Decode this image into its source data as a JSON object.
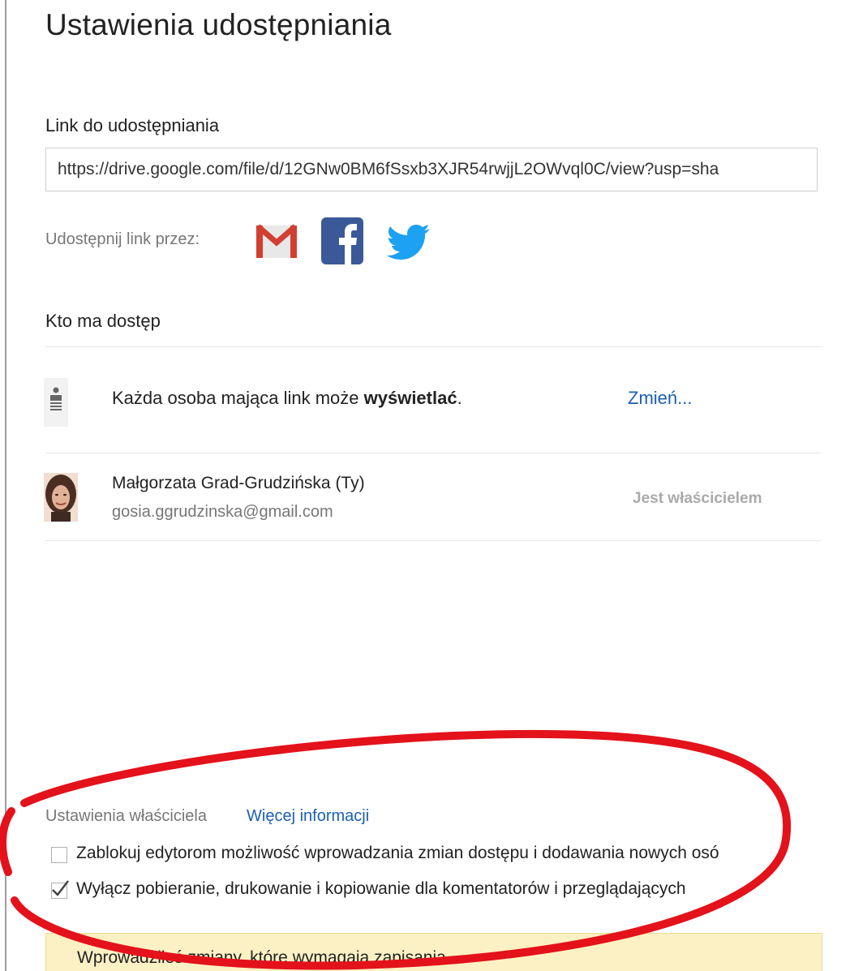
{
  "dialog": {
    "title": "Ustawienia udostępniania"
  },
  "link_section": {
    "label": "Link do udostępniania",
    "url": "https://drive.google.com/file/d/12GNw0BM6fSsxb3XJR54rwjjL2OWvql0C/view?usp=sha",
    "share_via_label": "Udostępnij link przez:",
    "share_icons": [
      "gmail-icon",
      "facebook-icon",
      "twitter-icon"
    ]
  },
  "access_section": {
    "label": "Kto ma dostęp",
    "link_row": {
      "text_prefix": "Każda osoba mająca link może ",
      "text_bold": "wyświetlać",
      "text_suffix": ".",
      "change_label": "Zmień..."
    },
    "owner_row": {
      "name": "Małgorzata Grad-Grudzińska (Ty)",
      "email": "gosia.ggrudzinska@gmail.com",
      "role": "Jest właścicielem"
    }
  },
  "owner_settings": {
    "label": "Ustawienia właściciela",
    "more_info": "Więcej informacji",
    "options": [
      {
        "label": "Zablokuj edytorom możliwość wprowadzania zmian dostępu i dodawania nowych osó",
        "checked": false
      },
      {
        "label": "Wyłącz pobieranie, drukowanie i kopiowanie dla komentatorów i przeglądających",
        "checked": true
      }
    ]
  },
  "banner": {
    "text": "Wprowadziłeś zmiany, które wymagają zapisania."
  },
  "colors": {
    "link_blue": "#1a5fb4",
    "banner_bg": "#fcf1c4",
    "annotation_red": "#e3121b",
    "facebook_blue": "#3b5998",
    "twitter_blue": "#1da1f2"
  }
}
